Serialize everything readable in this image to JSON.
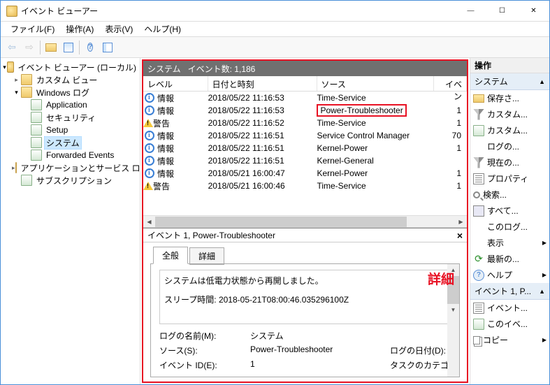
{
  "window": {
    "title": "イベント ビューアー"
  },
  "menu": {
    "file": "ファイル(F)",
    "action": "操作(A)",
    "view": "表示(V)",
    "help": "ヘルプ(H)"
  },
  "tree": {
    "root": "イベント ビューアー (ローカル)",
    "customViews": "カスタム ビュー",
    "windowsLogs": "Windows ログ",
    "application": "Application",
    "security": "セキュリティ",
    "setup": "Setup",
    "system": "システム",
    "forwarded": "Forwarded Events",
    "appServiceLogs": "アプリケーションとサービス ログ",
    "subscriptions": "サブスクリプション"
  },
  "listPane": {
    "title": "システム",
    "countLabel": "イベント数: 1,186",
    "columns": {
      "level": "レベル",
      "date": "日付と時刻",
      "source": "ソース",
      "id": "イベン"
    }
  },
  "events": [
    {
      "level": "情報",
      "icon": "info",
      "date": "2018/05/22 11:16:53",
      "source": "Time-Service",
      "id": ""
    },
    {
      "level": "情報",
      "icon": "info",
      "date": "2018/05/22 11:16:53",
      "source": "Power-Troubleshooter",
      "id": "1",
      "highlight": true
    },
    {
      "level": "警告",
      "icon": "warn",
      "date": "2018/05/22 11:16:52",
      "source": "Time-Service",
      "id": "1"
    },
    {
      "level": "情報",
      "icon": "info",
      "date": "2018/05/22 11:16:51",
      "source": "Service Control Manager",
      "id": "70"
    },
    {
      "level": "情報",
      "icon": "info",
      "date": "2018/05/22 11:16:51",
      "source": "Kernel-Power",
      "id": "1"
    },
    {
      "level": "情報",
      "icon": "info",
      "date": "2018/05/22 11:16:51",
      "source": "Kernel-General",
      "id": ""
    },
    {
      "level": "情報",
      "icon": "info",
      "date": "2018/05/21 16:00:47",
      "source": "Kernel-Power",
      "id": "1"
    },
    {
      "level": "警告",
      "icon": "warn",
      "date": "2018/05/21 16:00:46",
      "source": "Time-Service",
      "id": "1"
    }
  ],
  "detail": {
    "header": "イベント 1, Power-Troubleshooter",
    "tabs": {
      "general": "全般",
      "detail": "詳細"
    },
    "overlay": "詳細",
    "message": "システムは低電力状態から再開しました。",
    "sleepTime": "スリープ時間: 2018-05-21T08:00:46.035296100Z",
    "props": {
      "logNameLabel": "ログの名前(M):",
      "logName": "システム",
      "sourceLabel": "ソース(S):",
      "source": "Power-Troubleshooter",
      "logDateLabel": "ログの日付(D):",
      "eventIdLabel": "イベント ID(E):",
      "eventId": "1",
      "taskCatLabel": "タスクのカテゴリ(Y):"
    }
  },
  "actions": {
    "header": "操作",
    "section1": "システム",
    "section2": "イベント 1, P...",
    "items1": [
      {
        "label": "保存さ...",
        "icon": "folderopen"
      },
      {
        "label": "カスタム...",
        "icon": "filter"
      },
      {
        "label": "カスタム...",
        "icon": "log"
      },
      {
        "label": "ログの...",
        "icon": ""
      },
      {
        "label": "現在の...",
        "icon": "filter"
      },
      {
        "label": "プロパティ",
        "icon": "prop"
      },
      {
        "label": "検索...",
        "icon": "search"
      },
      {
        "label": "すべて...",
        "icon": "save"
      },
      {
        "label": "このログ...",
        "icon": ""
      },
      {
        "label": "表示",
        "icon": "",
        "arrow": true
      },
      {
        "label": "最新の...",
        "icon": "refresh"
      },
      {
        "label": "ヘルプ",
        "icon": "help",
        "arrow": true
      }
    ],
    "items2": [
      {
        "label": "イベント...",
        "icon": "prop"
      },
      {
        "label": "このイベ...",
        "icon": "log"
      },
      {
        "label": "コピー",
        "icon": "copy",
        "arrow": true
      }
    ]
  }
}
